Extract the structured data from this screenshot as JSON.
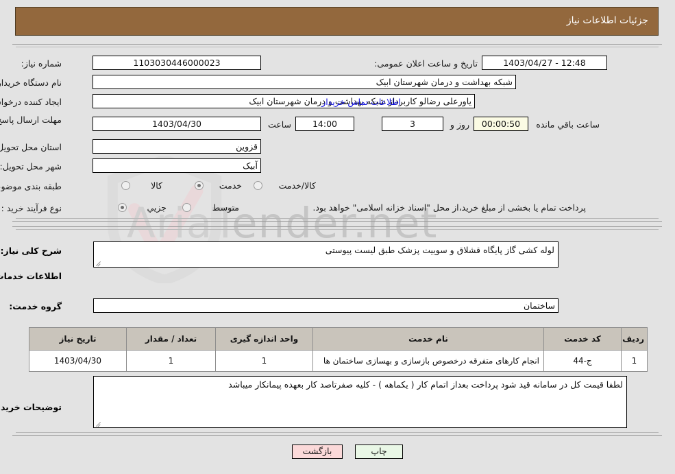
{
  "header": {
    "title": "جزئیات اطلاعات نیاز"
  },
  "top_form": {
    "labels": {
      "need_number": "شماره نیاز:",
      "buyer_org": "نام دستگاه خریدار:",
      "requester": "ایجاد کننده درخواست:",
      "deadline": "مهلت ارسال پاسخ: تا تاریخ:",
      "province": "استان محل تحویل:",
      "city": "شهر محل تحویل:",
      "classification": "طبقه بندی موضوعی:",
      "purchase_type": "نوع فرآیند خرید :",
      "announce_datetime": "تاریخ و ساعت اعلان عمومی:",
      "hour": "ساعت",
      "day_and": "روز و",
      "hours_remaining": "ساعت باقي مانده"
    },
    "values": {
      "need_number": "1103030446000023",
      "buyer_org": "شبکه بهداشت و درمان شهرستان ابیک",
      "requester": "یاورعلی رضالو کاربرداز شبکه بهداشت و درمان شهرستان ابیک",
      "deadline_date": "1403/04/30",
      "deadline_hour": "14:00",
      "remaining_days": "3",
      "remaining_timer": "00:00:50",
      "province": "قزوین",
      "city": "آبیک",
      "announce_datetime": "1403/04/27 - 12:48"
    },
    "buyer_contact_link": "اطلاعات تماس خریدار",
    "classification_options": [
      {
        "label": "کالا",
        "selected": false
      },
      {
        "label": "خدمت",
        "selected": true
      },
      {
        "label": "کالا/خدمت",
        "selected": false
      }
    ],
    "purchase_options": [
      {
        "label": "جزیي",
        "selected": true
      },
      {
        "label": "متوسط",
        "selected": false
      }
    ],
    "payment_note": "پرداخت تمام یا بخشی از مبلغ خرید،از محل \"اسناد خزانه اسلامی\" خواهد بود."
  },
  "middle": {
    "need_summary_label": "شرح کلی نیاز:",
    "need_summary_value": "لوله کشی گاز پایگاه قشلاق و سوییت پزشک طبق لیست پیوستی",
    "services_heading": "اطلاعات خدمات مورد نیاز",
    "service_group_label": "گروه خدمت:",
    "service_group_value": "ساختمان",
    "buyer_notes_label": "توضیحات خریدار:",
    "buyer_notes_value": "لطفا قیمت کل در سامانه قید شود پرداخت بعداز اتمام کار ( یکماهه ) - کلیه صفرتاصد کار بعهده پیمانکار میباشد"
  },
  "table": {
    "headers": [
      "ردیف",
      "کد خدمت",
      "نام خدمت",
      "واحد اندازه گیری",
      "تعداد / مقدار",
      "تاریخ نیاز"
    ],
    "rows": [
      {
        "row_no": "1",
        "service_code": "ج-44",
        "service_name": "انجام کارهای متفرقه درخصوص بازسازی و بهسازی ساختمان ها",
        "unit": "1",
        "quantity": "1",
        "need_date": "1403/04/30"
      }
    ]
  },
  "buttons": {
    "print": "چاپ",
    "back": "بازگشت"
  },
  "watermark": {
    "text_light": "AriaT",
    "text_dark": "ender.net"
  },
  "colors": {
    "header_bg": "#93683d",
    "page_bg": "#e3e3e3",
    "link": "#1111dd",
    "timer_bg": "#fbfbe4",
    "table_header_bg": "#c9c4bb",
    "print_btn_bg": "#e9f7e6",
    "back_btn_bg": "#fbd9d9"
  }
}
